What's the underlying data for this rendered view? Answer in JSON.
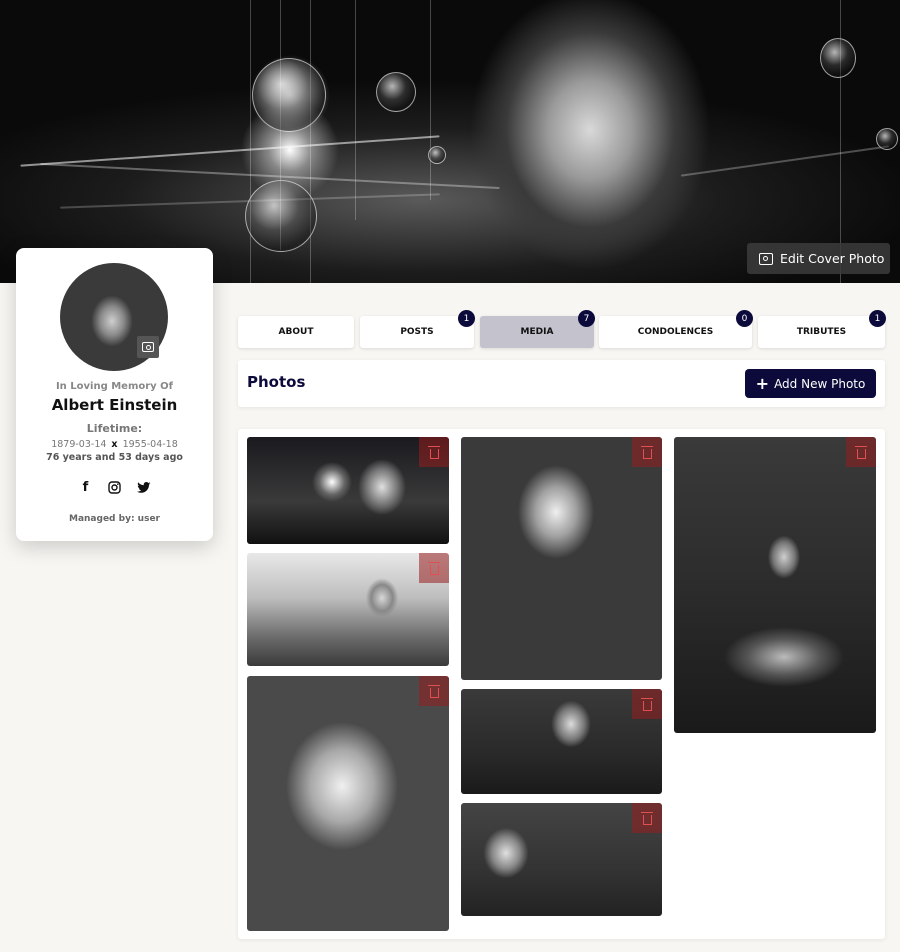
{
  "cover": {
    "edit_label": "Edit Cover Photo",
    "icon": "camera-icon"
  },
  "profile": {
    "in_memory_label": "In Loving Memory Of",
    "name": "Albert Einstein",
    "lifetime_label": "Lifetime:",
    "birth_date": "1879-03-14",
    "separator": "x",
    "death_date": "1955-04-18",
    "age_text": "76 years and 53 days ago",
    "managed_by": "Managed by: user",
    "socials": [
      "facebook-icon",
      "instagram-icon",
      "twitter-icon"
    ]
  },
  "tabs": [
    {
      "label": "ABOUT",
      "count": null,
      "active": false
    },
    {
      "label": "POSTS",
      "count": "1",
      "active": false
    },
    {
      "label": "MEDIA",
      "count": "7",
      "active": true
    },
    {
      "label": "CONDOLENCES",
      "count": "0",
      "active": false
    },
    {
      "label": "TRIBUTES",
      "count": "1",
      "active": false
    }
  ],
  "photos_section": {
    "title": "Photos",
    "add_button_label": "Add New Photo"
  },
  "colors": {
    "accent": "#0c0a3a",
    "active_tab": "#c3c2cd",
    "delete": "#e05050",
    "page_bg": "#f7f6f2"
  }
}
